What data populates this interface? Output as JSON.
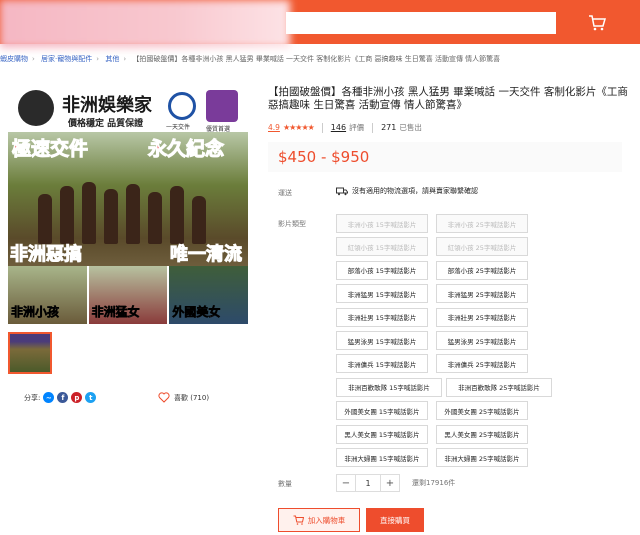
{
  "header": {
    "search_value": "",
    "search_icon": "search-icon",
    "cart_icon": "cart-icon"
  },
  "breadcrumb": [
    "蝦皮購物",
    "居家·寵物與配件",
    "其他",
    "【拍國破盤價】各種非洲小孩 黑人猛男 畢業喊話 一天交件 客制化影片《工商 惡搞趣味 生日驚喜 活動宣傳 情人節驚喜"
  ],
  "image": {
    "title": "非洲娛樂家",
    "subtitle": "價格穩定 品質保證",
    "clock_label": "一天交件",
    "badge_label": "優質首選",
    "red_1": "極速交件",
    "red_2": "永久紀念",
    "red_3": "非洲惡搞",
    "red_4": "唯一清流",
    "thumbs": [
      "非洲小孩",
      "非洲猛女",
      "外國美女"
    ]
  },
  "share": {
    "label": "分享:",
    "like_label": "喜歡 (710)"
  },
  "product": {
    "title": "【拍國破盤價】各種非洲小孩 黑人猛男 畢業喊話 一天交件 客制化影片《工商 惡搞趣味 生日驚喜 活動宣傳 情人節驚喜》",
    "score": "4.9",
    "stars": "★★★★★",
    "reviews_count": "146",
    "reviews_label": "評價",
    "sold_count": "271",
    "sold_label": "已售出",
    "price": "$450 - $950"
  },
  "labels": {
    "shipping": "運送",
    "shipping_text": "沒有適用的物流選項，請與賣家聯繫確認",
    "variant": "影片類型",
    "quantity": "數量",
    "qty_value": "1",
    "stock": "還剩17916件",
    "add_cart": "加入購物車",
    "buy_now": "直接購買"
  },
  "variants": [
    {
      "label": "非洲小孩 15字喊話影片",
      "disabled": true
    },
    {
      "label": "非洲小孩 25字喊話影片",
      "disabled": true
    },
    {
      "label": "紅領小孩 15字喊話影片",
      "disabled": true
    },
    {
      "label": "紅領小孩 25字喊話影片",
      "disabled": true
    },
    {
      "label": "部落小孩 15字喊話影片",
      "disabled": false
    },
    {
      "label": "部落小孩 25字喊話影片",
      "disabled": false
    },
    {
      "label": "非洲猛男 15字喊話影片",
      "disabled": false
    },
    {
      "label": "非洲猛男 25字喊話影片",
      "disabled": false
    },
    {
      "label": "非洲壯男 15字喊話影片",
      "disabled": false
    },
    {
      "label": "非洲壯男 25字喊話影片",
      "disabled": false
    },
    {
      "label": "猛男泳男 15字喊話影片",
      "disabled": false
    },
    {
      "label": "猛男泳男 25字喊話影片",
      "disabled": false
    },
    {
      "label": "非洲傭兵 15字喊話影片",
      "disabled": false
    },
    {
      "label": "非洲傭兵 25字喊話影片",
      "disabled": false
    },
    {
      "label": "非洲百歡歌隊 15字喊話影片",
      "disabled": false
    },
    {
      "label": "非洲百歡歌隊 25字喊話影片",
      "disabled": false
    },
    {
      "label": "外國美女團 15字喊話影片",
      "disabled": false
    },
    {
      "label": "外國美女團 25字喊話影片",
      "disabled": false
    },
    {
      "label": "黑人美女團 15字喊話影片",
      "disabled": false
    },
    {
      "label": "黑人美女團 25字喊話影片",
      "disabled": false
    },
    {
      "label": "非洲大婦團 15字喊話影片",
      "disabled": false
    },
    {
      "label": "非洲大婦團 25字喊話影片",
      "disabled": false
    }
  ],
  "colors": {
    "accent": "#ee4d2d",
    "header": "#f1582f"
  }
}
